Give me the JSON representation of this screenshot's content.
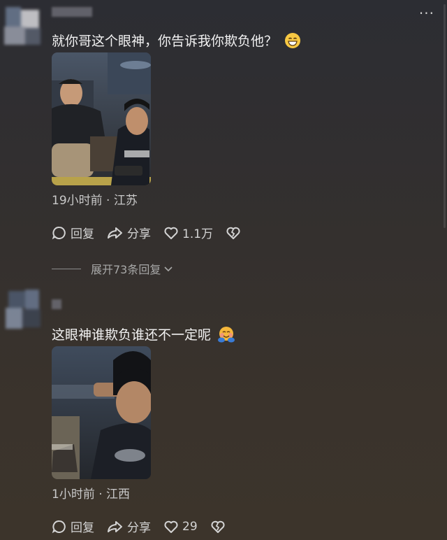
{
  "header": {
    "more_label": "···"
  },
  "comments": [
    {
      "text": "就你哥这个眼神，你告诉我你欺负他？",
      "emoji_icon": "grinning-emoji-icon",
      "meta": "19小时前 · 江苏",
      "reply_label": "回复",
      "share_label": "分享",
      "like_count": "1.1万",
      "expand_label": "展开73条回复"
    },
    {
      "text": "这眼神谁欺负谁还不一定呢",
      "emoji_icon": "hugging-face-emoji-icon",
      "meta": "1小时前 · 江西",
      "reply_label": "回复",
      "share_label": "分享",
      "like_count": "29"
    }
  ],
  "colors": {
    "background": "#34302e",
    "text": "#f2f2f2",
    "secondary_text": "#c9c9c9"
  }
}
